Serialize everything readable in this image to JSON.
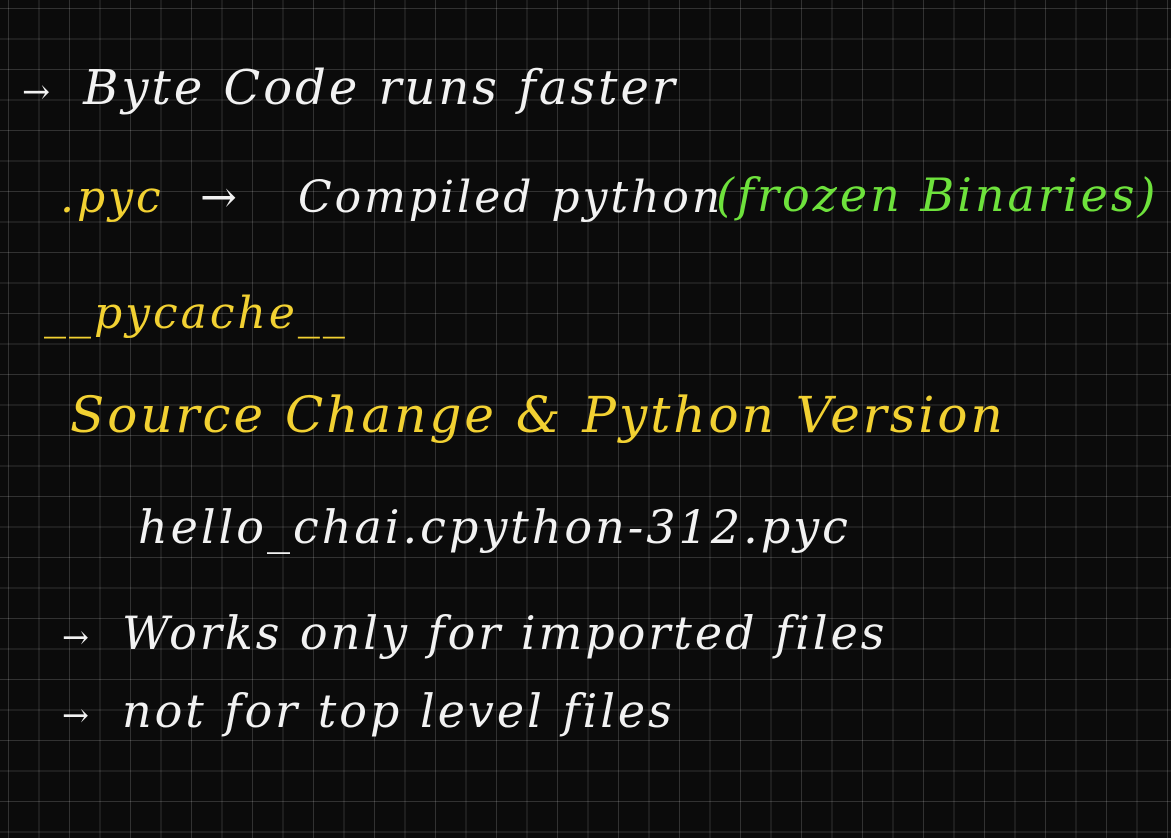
{
  "lines": {
    "byte_code": {
      "arrow": "→",
      "text": "Byte Code runs faster"
    },
    "pyc": {
      "ext": ".pyc",
      "arrow": "→",
      "text": "Compiled python",
      "frozen": "(frozen Binaries)"
    },
    "pycache": {
      "text": "__pycache__"
    },
    "source_change": {
      "text": "Source Change & Python Version"
    },
    "filename": {
      "text": "hello_chai.cpython-312.pyc"
    },
    "imported": {
      "arrow": "→",
      "text": "Works only for imported files"
    },
    "top_level": {
      "arrow": "→",
      "text": "not for top level files"
    }
  },
  "colors": {
    "background": "#0b0b0b",
    "white_ink": "#f2f2f2",
    "yellow_ink": "#f2d132",
    "green_ink": "#6ee23c"
  }
}
